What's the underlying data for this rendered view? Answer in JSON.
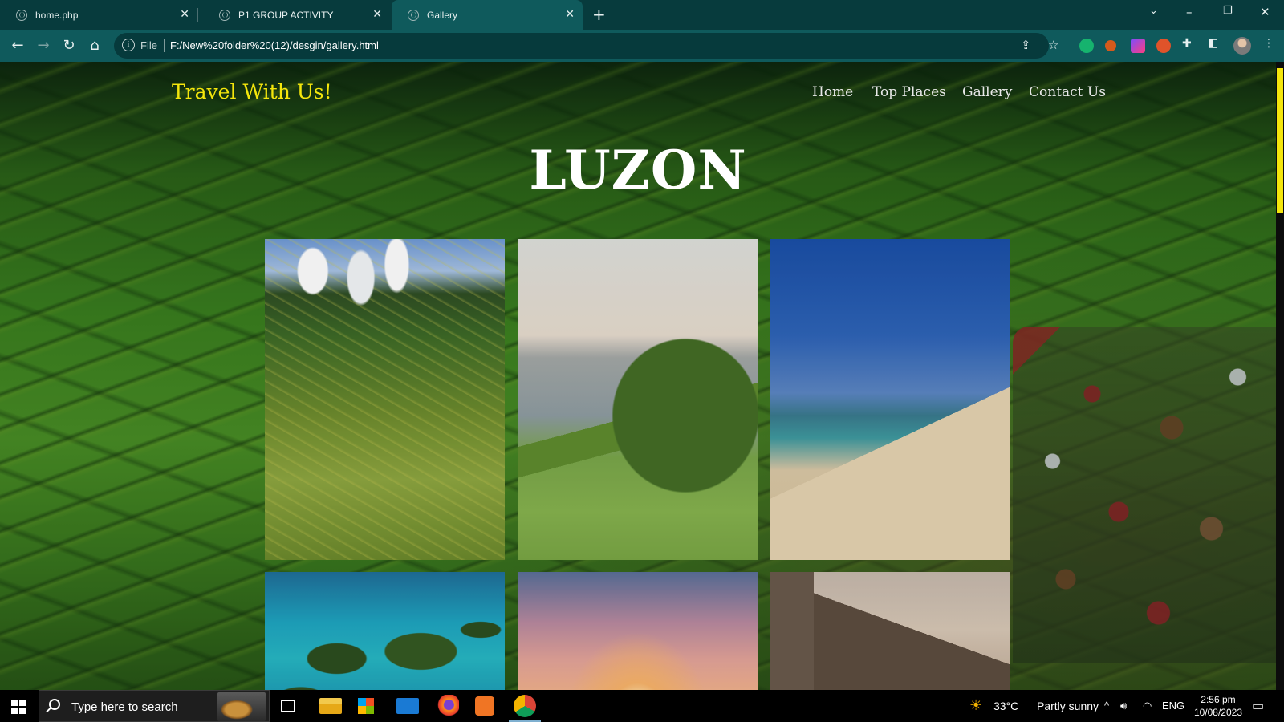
{
  "browser": {
    "tabs": [
      {
        "label": "home.php",
        "active": false
      },
      {
        "label": "P1 GROUP ACTIVITY",
        "active": false
      },
      {
        "label": "Gallery",
        "active": true
      }
    ],
    "address": {
      "scheme_label": "File",
      "url": "F:/New%20folder%20(12)/desgin/gallery.html"
    }
  },
  "site": {
    "brand": "Travel With Us!",
    "nav": [
      "Home",
      "Top Places",
      "Gallery",
      "Contact Us"
    ],
    "heading": "LUZON",
    "gallery": [
      {
        "subject": "rice-terraces"
      },
      {
        "subject": "coastal-hills"
      },
      {
        "subject": "beach"
      },
      {
        "subject": "lagoon-islands"
      },
      {
        "subject": "sunset"
      },
      {
        "subject": "heritage-houses"
      }
    ]
  },
  "taskbar": {
    "search_placeholder": "Type here to search",
    "weather": {
      "temp": "33°C",
      "condition": "Partly sunny"
    },
    "language": "ENG",
    "time": "2:56 pm",
    "date": "10/08/2023"
  },
  "colors": {
    "brand": "#f4e60c",
    "chrome": "#0f5a5c",
    "tab_strip": "#073b3d"
  }
}
